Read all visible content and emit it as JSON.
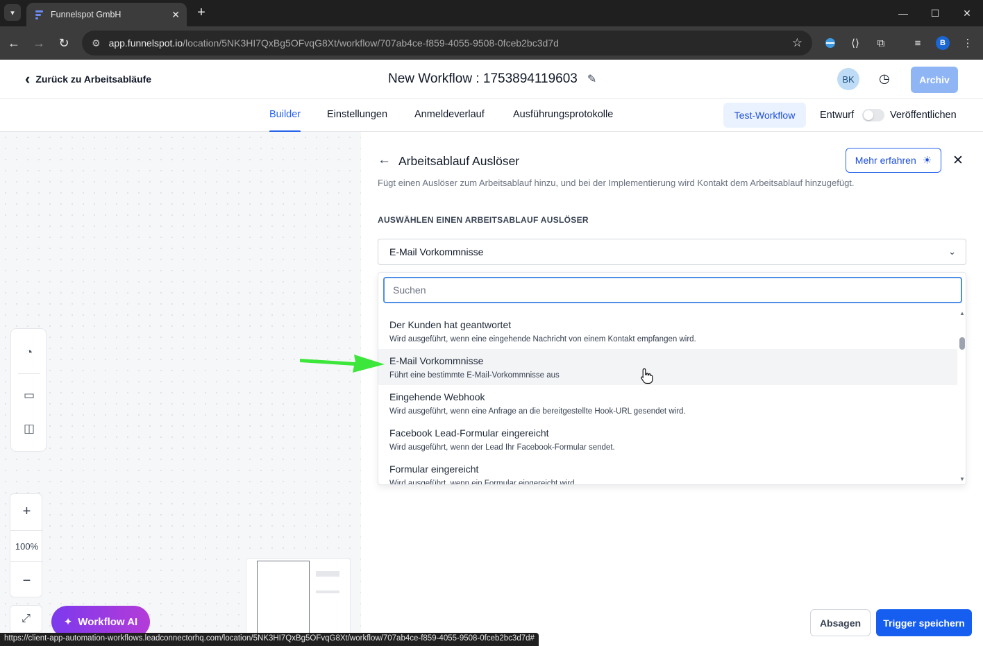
{
  "browser": {
    "tab_title": "Funnelspot GmbH",
    "url_host": "app.funnelspot.io",
    "url_path": "/location/5NK3HI7QxBg5OFvqG8Xt/workflow/707ab4ce-f859-4055-9508-0fceb2bc3d7d",
    "profile_initial": "B",
    "status_url": "https://client-app-automation-workflows.leadconnectorhq.com/location/5NK3HI7QxBg5OFvqG8Xt/workflow/707ab4ce-f859-4055-9508-0fceb2bc3d7d#"
  },
  "header": {
    "back_label": "Zurück zu Arbeitsabläufe",
    "workflow_title": "New Workflow : 1753894119603",
    "avatar_initials": "BK",
    "archive_label": "Archiv"
  },
  "tabs": [
    {
      "label": "Builder",
      "active": true
    },
    {
      "label": "Einstellungen"
    },
    {
      "label": "Anmeldeverlauf"
    },
    {
      "label": "Ausführungsprotokolle"
    }
  ],
  "actions": {
    "test_label": "Test-Workflow",
    "draft_label": "Entwurf",
    "publish_label": "Veröffentlichen"
  },
  "canvas": {
    "zoom_level": "100%",
    "ai_label": "Workflow AI"
  },
  "panel": {
    "title": "Arbeitsablauf Auslöser",
    "learn_more_label": "Mehr erfahren",
    "description": "Fügt einen Auslöser zum Arbeitsablauf hinzu, und bei der Implementierung wird Kontakt dem Arbeitsablauf hinzugefügt.",
    "section_label": "AUSWÄHLEN EINEN ARBEITSABLAUF AUSLÖSER",
    "selected_value": "E-Mail Vorkommnisse",
    "search_placeholder": "Suchen",
    "options": [
      {
        "title": "Der Kunden hat geantwortet",
        "desc": "Wird ausgeführt, wenn eine eingehende Nachricht von einem Kontakt empfangen wird."
      },
      {
        "title": "E-Mail Vorkommnisse",
        "desc": "Führt eine bestimmte E-Mail-Vorkommnisse aus"
      },
      {
        "title": "Eingehende Webhook",
        "desc": "Wird ausgeführt, wenn eine Anfrage an die bereitgestellte Hook-URL gesendet wird."
      },
      {
        "title": "Facebook Lead-Formular eingereicht",
        "desc": "Wird ausgeführt, wenn der Lead Ihr Facebook-Formular sendet."
      },
      {
        "title": "Formular eingereicht",
        "desc": "Wird ausgeführt, wenn ein Formular eingereicht wird."
      }
    ],
    "cancel_label": "Absagen",
    "save_label": "Trigger speichern"
  },
  "colors": {
    "primary": "#155eef",
    "accent_text": "#2563eb",
    "ai_gradient_start": "#7c3aed",
    "ai_gradient_end": "#b43bd8",
    "annotation_arrow": "#3de63a"
  }
}
